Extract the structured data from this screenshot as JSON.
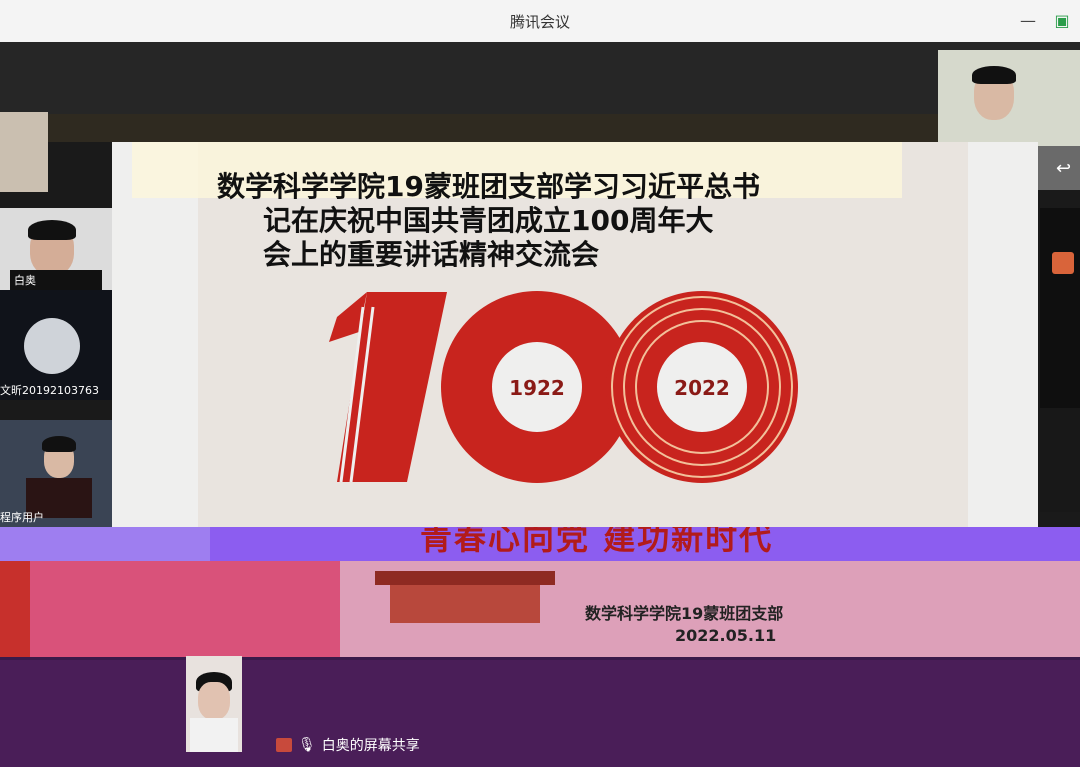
{
  "window": {
    "title": "腾讯会议"
  },
  "slide": {
    "title_line1": "数学科学学院19蒙班团支部学习习近平总书",
    "title_line2": "记在庆祝中国共青团成立100周年大",
    "title_line3": "会上的重要讲话精神交流会",
    "logo_number": "100",
    "year_start": "1922",
    "year_end": "2022",
    "slogan": "青春心向党 建功新时代",
    "organization": "数学科学学院19蒙班团支部",
    "date": "2022.05.11"
  },
  "participants": [
    {
      "name": "白奥"
    },
    {
      "name": "文昕20192103763"
    },
    {
      "name": "程序用户"
    }
  ],
  "share_status": "白奥的屏幕共享",
  "colors": {
    "accent_red": "#c7302c",
    "logo_red": "#c8241e",
    "gold": "#d9a441"
  }
}
